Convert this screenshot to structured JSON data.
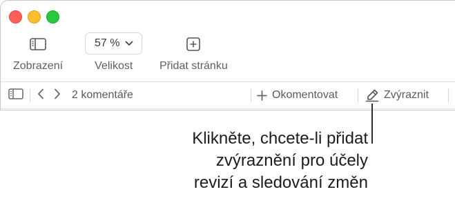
{
  "toolbar": {
    "view": {
      "label": "Zobrazení",
      "icon": "sidebar-icon"
    },
    "zoom": {
      "label": "Velikost",
      "value": "57 %",
      "icon": "chevron-down-icon"
    },
    "add_page": {
      "label": "Přidat stránku",
      "icon": "plus-square-icon"
    }
  },
  "subbar": {
    "comments_count": "2 komentáře",
    "add_comment": "Okomentovat",
    "highlight": "Zvýraznit"
  },
  "callout": {
    "line1": "Klikněte, chcete-li přidat",
    "line2": "zvýraznění pro účely",
    "line3": "revizí a sledování změn"
  },
  "colors": {
    "close": "#fe5f57",
    "minimize": "#febc2e",
    "zoom": "#28c840"
  }
}
